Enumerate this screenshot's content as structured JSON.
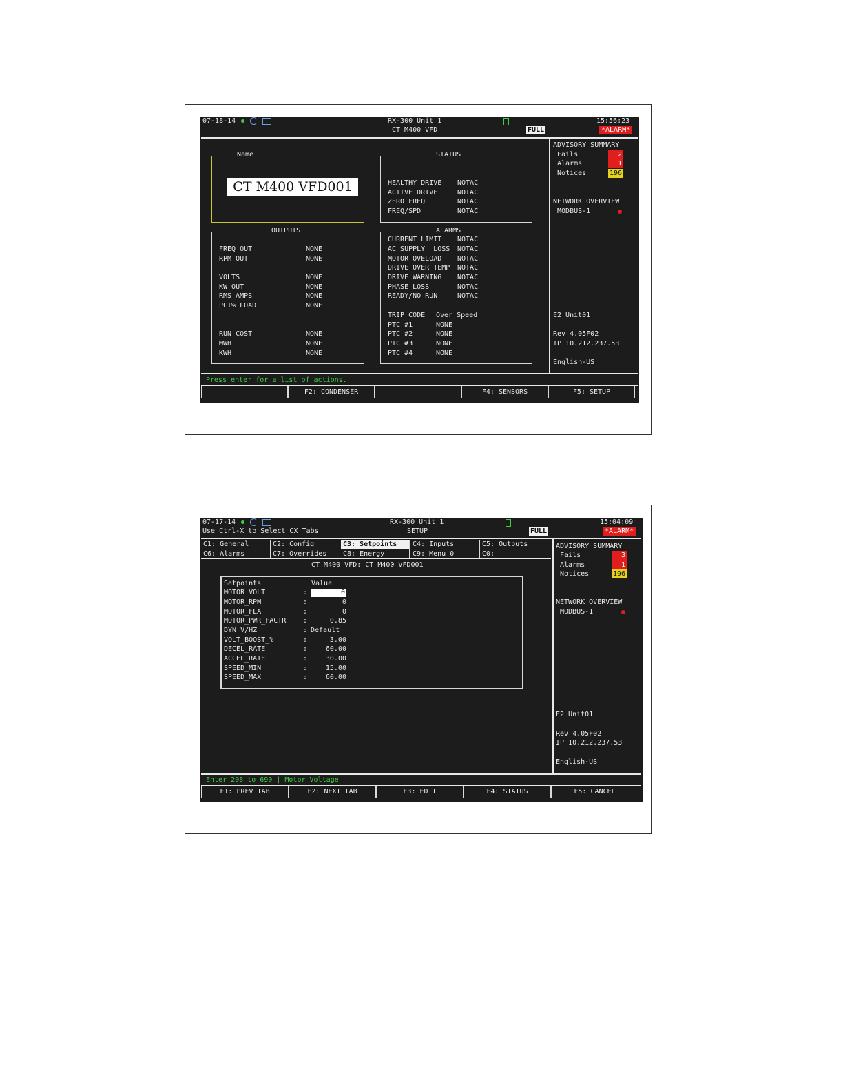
{
  "screen1": {
    "header": {
      "date": "07-18-14",
      "title": "RX-300 Unit 1",
      "subtitle": "CT M400 VFD",
      "time": "15:56:23",
      "mode_badge": "FULL",
      "alarm_badge": "*ALARM*"
    },
    "name_panel": {
      "legend": "Name",
      "value": "CT M400 VFD001"
    },
    "status_panel": {
      "legend": "STATUS",
      "rows": [
        {
          "label": "HEALTHY DRIVE",
          "value": "NOTAC"
        },
        {
          "label": "ACTIVE DRIVE",
          "value": "NOTAC"
        },
        {
          "label": "ZERO FREQ",
          "value": "NOTAC"
        },
        {
          "label": "FREQ/SPD",
          "value": "NOTAC"
        }
      ]
    },
    "outputs_panel": {
      "legend": "OUTPUTS",
      "rows": [
        {
          "label": "FREQ OUT",
          "value": "NONE"
        },
        {
          "label": "RPM OUT",
          "value": "NONE"
        },
        {
          "label": "VOLTS",
          "value": "NONE"
        },
        {
          "label": "KW OUT",
          "value": "NONE"
        },
        {
          "label": "RMS AMPS",
          "value": "NONE"
        },
        {
          "label": "PCT% LOAD",
          "value": "NONE"
        },
        {
          "label": "RUN COST",
          "value": "NONE"
        },
        {
          "label": "MWH",
          "value": "NONE"
        },
        {
          "label": "KWH",
          "value": "NONE"
        }
      ]
    },
    "alarms_panel": {
      "legend": "ALARMS",
      "rows": [
        {
          "label": "CURRENT LIMIT",
          "value": "NOTAC"
        },
        {
          "label": "AC SUPPLY  LOSS",
          "value": "NOTAC"
        },
        {
          "label": "MOTOR OVELOAD",
          "value": "NOTAC"
        },
        {
          "label": "DRIVE OVER TEMP",
          "value": "NOTAC"
        },
        {
          "label": "DRIVE WARNING",
          "value": "NOTAC"
        },
        {
          "label": "PHASE LOSS",
          "value": "NOTAC"
        },
        {
          "label": "READY/NO RUN",
          "value": "NOTAC"
        }
      ],
      "trip_code_label": "TRIP CODE",
      "trip_code_value": "Over Speed",
      "ptc_rows": [
        {
          "label": "PTC #1",
          "value": "NONE"
        },
        {
          "label": "PTC #2",
          "value": "NONE"
        },
        {
          "label": "PTC #3",
          "value": "NONE"
        },
        {
          "label": "PTC #4",
          "value": "NONE"
        }
      ]
    },
    "sidebar": {
      "advisory_title": "ADVISORY SUMMARY",
      "fails_label": "Fails",
      "fails_count": "2",
      "alarms_label": "Alarms",
      "alarms_count": "1",
      "notices_label": "Notices",
      "notices_count": "196",
      "network_title": "NETWORK OVERVIEW",
      "network_item": "MODBUS-1",
      "unit": "E2 Unit01",
      "rev": "Rev 4.05F02",
      "ip": "IP 10.212.237.53",
      "language": "English-US"
    },
    "prompt": "Press enter for a list of actions.",
    "fkeys": [
      "",
      "F2: CONDENSER",
      "",
      "F4: SENSORS",
      "F5: SETUP"
    ]
  },
  "screen2": {
    "header": {
      "date": "07-17-14",
      "hint": "Use Ctrl-X to Select CX Tabs",
      "title": "RX-300 Unit 1",
      "subtitle": "SETUP",
      "time": "15:04:09",
      "mode_badge": "FULL",
      "alarm_badge": "*ALARM*"
    },
    "tabs_row1": [
      "C1: General",
      "C2: Config",
      "C3: Setpoints",
      "C4: Inputs",
      "C5: Outputs"
    ],
    "tabs_row2": [
      "C6: Alarms",
      "C7: Overrides",
      "C8: Energy",
      "C9: Menu 0",
      "C0:"
    ],
    "selected_tab": "C3: Setpoints",
    "panel_title": "CT M400 VFD: CT M400 VFD001",
    "table": {
      "col_setpoints": "Setpoints",
      "col_value": "Value",
      "rows": [
        {
          "name": "MOTOR_VOLT",
          "value": "0"
        },
        {
          "name": "MOTOR_RPM",
          "value": "0"
        },
        {
          "name": "MOTOR_FLA",
          "value": "0"
        },
        {
          "name": "MOTOR_PWR_FACTR",
          "value": "0.85"
        },
        {
          "name": "DYN_V/HZ",
          "value": "Default"
        },
        {
          "name": "VOLT_BOOST_%",
          "value": "3.00"
        },
        {
          "name": "DECEL_RATE",
          "value": "60.00"
        },
        {
          "name": "ACCEL_RATE",
          "value": "30.00"
        },
        {
          "name": "SPEED_MIN",
          "value": "15.00"
        },
        {
          "name": "SPEED_MAX",
          "value": "60.00"
        }
      ]
    },
    "sidebar": {
      "advisory_title": "ADVISORY SUMMARY",
      "fails_label": "Fails",
      "fails_count": "3",
      "alarms_label": "Alarms",
      "alarms_count": "1",
      "notices_label": "Notices",
      "notices_count": "196",
      "network_title": "NETWORK OVERVIEW",
      "network_item": "MODBUS-1",
      "unit": "E2 Unit01",
      "rev": "Rev 4.05F02",
      "ip": "IP 10.212.237.53",
      "language": "English-US"
    },
    "prompt": "Enter 208 to 690 | Motor Voltage",
    "fkeys": [
      "F1: PREV TAB",
      "F2: NEXT TAB",
      "F3: EDIT",
      "F4: STATUS",
      "F5: CANCEL"
    ]
  },
  "colors": {
    "screen_bg": "#1c1c1c",
    "text": "#e8e8e8",
    "alarm_red": "#e01e1e",
    "notice_yellow": "#e6d21a",
    "prompt_green": "#3fcf3f"
  },
  "icons": [
    "status-dot-icon",
    "refresh-icon",
    "keyboard-icon",
    "battery-icon",
    "network-status-dot-icon"
  ]
}
